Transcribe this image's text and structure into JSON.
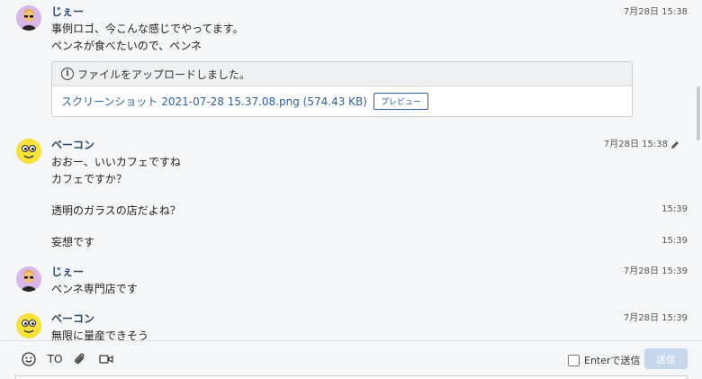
{
  "messages": [
    {
      "sender": "じぇー",
      "avatar": "jee",
      "time": "7月28日 15:38",
      "lines": [
        "事例ロゴ、今こんな感じでやってます。",
        "ペンネが食べたいので、ペンネ"
      ],
      "attachment": {
        "header": "ファイルをアップロードしました。",
        "file": "スクリーンショット 2021-07-28 15.37.08.png (574.43 KB)",
        "preview": "プレビュー"
      }
    },
    {
      "sender": "ベーコン",
      "avatar": "bacon",
      "time": "7月28日 15:38",
      "edited": true,
      "lines": [
        "おおー、いいカフェですね",
        "カフェですか？"
      ]
    },
    {
      "continuation": true,
      "text": "透明のガラスの店だよね？",
      "time": "15:39"
    },
    {
      "continuation": true,
      "text": "妄想です",
      "time": "15:39"
    },
    {
      "sender": "じぇー",
      "avatar": "jee",
      "time": "7月28日 15:39",
      "lines": [
        "ペンネ専門店です"
      ]
    },
    {
      "sender": "ベーコン",
      "avatar": "bacon",
      "time": "7月28日 15:39",
      "lines": [
        "無限に量産できそう"
      ]
    }
  ],
  "composer": {
    "to_label": "TO",
    "enter_send_label": "Enterで送信",
    "send_label": "送信"
  },
  "icons": {
    "emoji": "smiley-icon",
    "attach": "paperclip-icon",
    "video": "video-icon",
    "info": "info-icon",
    "edit": "pencil-icon"
  },
  "colors": {
    "name": "#2e4a63",
    "link": "#2b5ea7",
    "send_disabled": "#c6d7ec",
    "background": "#f5f6f8"
  }
}
